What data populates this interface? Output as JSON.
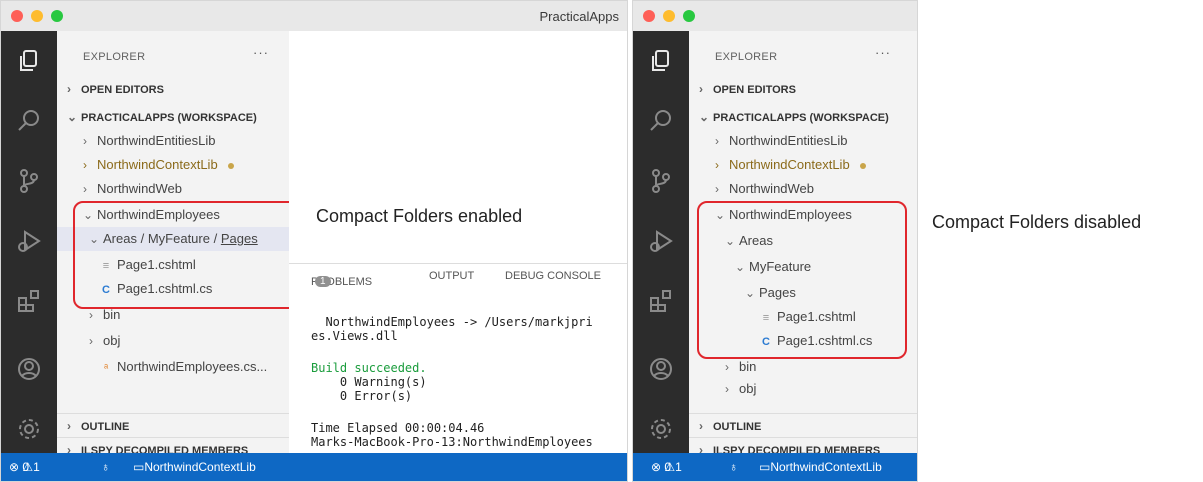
{
  "left_window": {
    "title": "PracticalApps",
    "explorer_header": "EXPLORER",
    "more": "···",
    "open_editors": "OPEN EDITORS",
    "workspace": "PRACTICALAPPS (WORKSPACE)",
    "projects": [
      "NorthwindEntitiesLib",
      "NorthwindContextLib",
      "NorthwindWeb",
      "NorthwindEmployees"
    ],
    "path_segments": [
      "Areas",
      "MyFeature",
      "Pages"
    ],
    "path_sep": "/",
    "files": [
      "Page1.cshtml",
      "Page1.cshtml.cs"
    ],
    "folders": [
      "bin",
      "obj"
    ],
    "csproj": "NorthwindEmployees.cs...",
    "outline": "OUTLINE",
    "ilspy": "ILSPY DECOMPILED MEMBERS",
    "status": {
      "errors": "0",
      "warnings": "1",
      "branch": "NorthwindContextLib"
    },
    "panel": {
      "problems": "PROBLEMS",
      "problems_count": "1",
      "output": "OUTPUT",
      "debug": "DEBUG CONSOLE",
      "lines": [
        "  NorthwindEmployees -> /Users/markjpri",
        "es.Views.dll",
        "",
        "Build succeeded.",
        "    0 Warning(s)",
        "    0 Error(s)",
        "",
        "Time Elapsed 00:00:04.46",
        "Marks-MacBook-Pro-13:NorthwindEmployees"
      ]
    }
  },
  "right_window": {
    "explorer_header": "EXPLORER",
    "more": "···",
    "open_editors": "OPEN EDITORS",
    "workspace": "PRACTICALAPPS (WORKSPACE)",
    "projects": [
      "NorthwindEntitiesLib",
      "NorthwindContextLib",
      "NorthwindWeb",
      "NorthwindEmployees"
    ],
    "tree": [
      "Areas",
      "MyFeature",
      "Pages"
    ],
    "files": [
      "Page1.cshtml",
      "Page1.cshtml.cs"
    ],
    "folders": [
      "bin",
      "obj"
    ],
    "outline": "OUTLINE",
    "ilspy": "ILSPY DECOMPILED MEMBERS",
    "status": {
      "errors": "0",
      "warnings": "1",
      "branch": "NorthwindContextLib"
    }
  },
  "captions": {
    "enabled": "Compact Folders enabled",
    "disabled": "Compact Folders disabled"
  },
  "colors": {
    "highlight": "#e0262c",
    "statusbar": "#0e68c4",
    "activitybar": "#2c2c2c",
    "modified": "#8b6a1a"
  }
}
